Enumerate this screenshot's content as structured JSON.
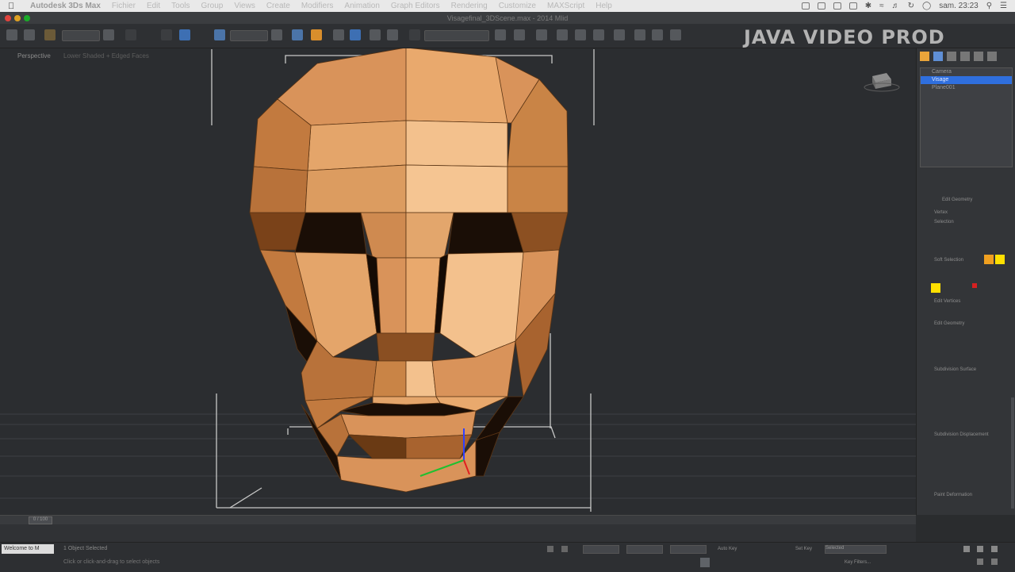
{
  "menubar": {
    "items": [
      "Autodesk 3Ds Max",
      "Fichier",
      "Edit",
      "Tools",
      "Group",
      "Views",
      "Create",
      "Modifiers",
      "Animation",
      "Graph Editors",
      "Rendering",
      "Customize",
      "MAXScript",
      "Help"
    ],
    "clock": "sam. 23:23"
  },
  "window": {
    "title": "Visagefinal_3DScene.max - 2014 Mlid"
  },
  "watermark": "JAVA VIDEO PROD",
  "viewport": {
    "label": "Perspective",
    "sublabel": "Lower Shaded + Edged Faces"
  },
  "scene_explorer": {
    "rows": [
      "Camera",
      "Visage",
      "Plane001"
    ],
    "selected_index": 1
  },
  "command_panel": {
    "section_title": "Edit Geometry",
    "rollout_labels": [
      "Vertex",
      "Selection",
      "Soft Selection",
      "Edit Vertices",
      "Edit Geometry",
      "Subdivision Surface",
      "Subdivision Displacement",
      "Paint Deformation"
    ]
  },
  "timeline": {
    "frame_label": "0 / 100"
  },
  "status": {
    "maxscript_label": "Welcome to M",
    "selection_status": "1 Object Selected",
    "hint": "Click or click-and-drag to select objects",
    "auto_key": "Auto Key",
    "set_key": "Set Key",
    "selected": "Selected",
    "key_filters": "Key Filters..."
  },
  "colors": {
    "skin_light": "#f3c18d",
    "skin_mid": "#d9935a",
    "skin_dark": "#8a4f22",
    "selection_blue": "#2f6fde",
    "swatch_yellow": "#ffe000",
    "swatch_red": "#d62020",
    "swatch_orange": "#f0a020"
  }
}
